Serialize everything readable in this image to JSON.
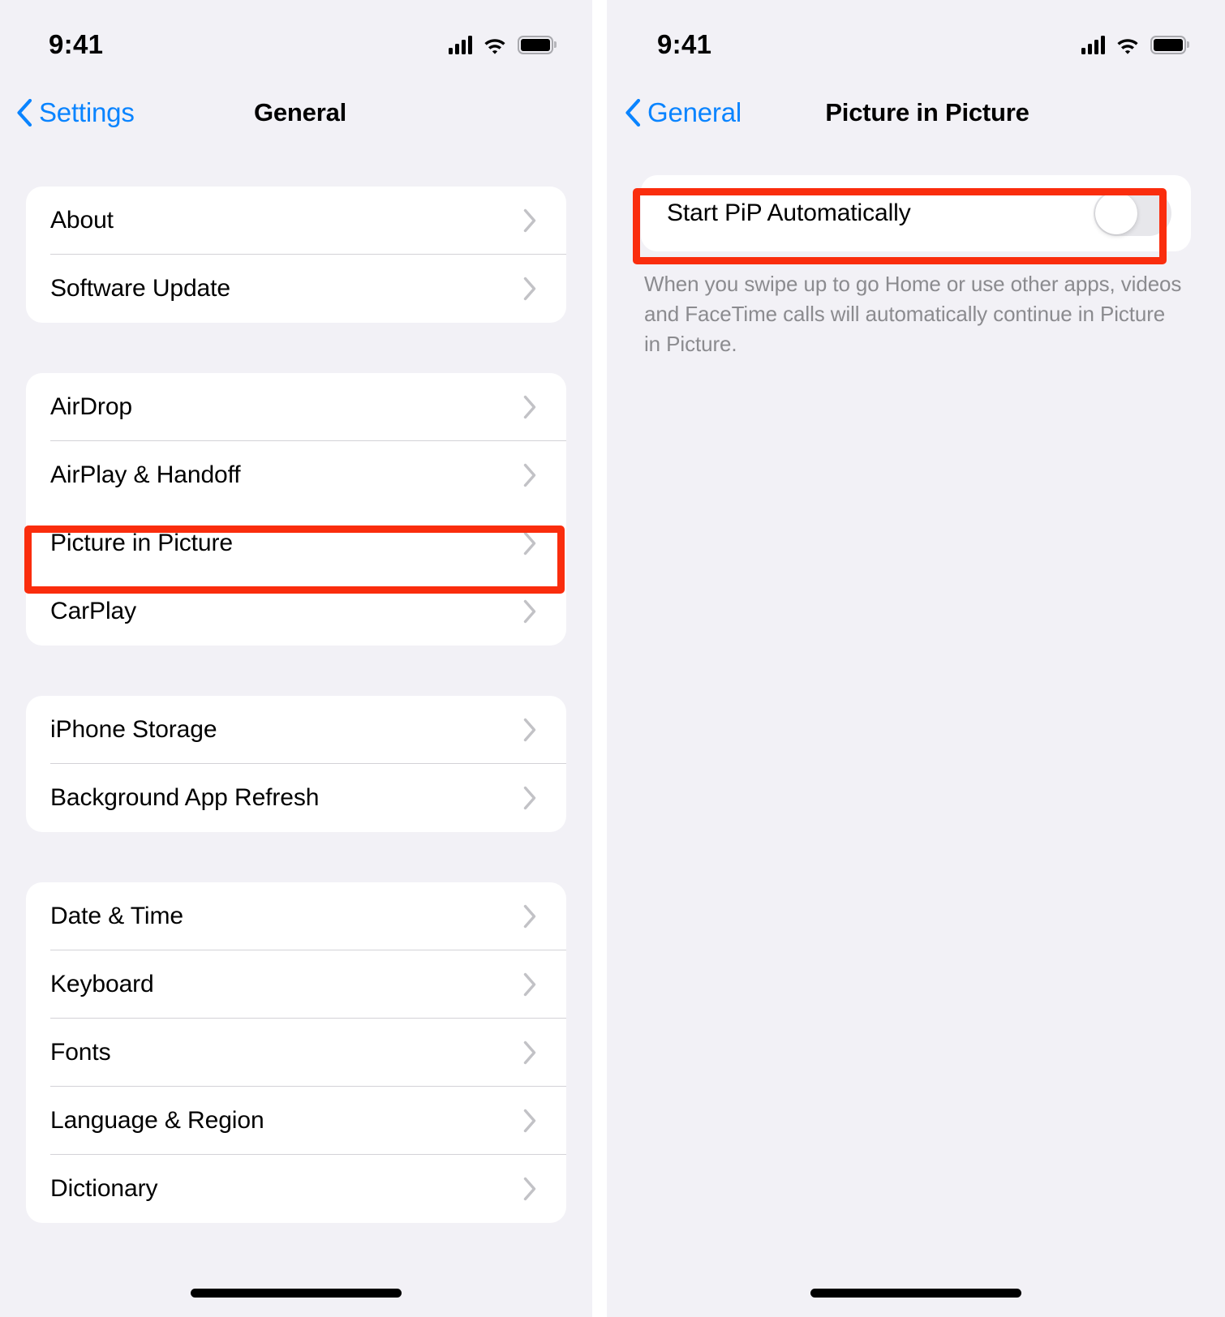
{
  "left_screen": {
    "status_bar": {
      "time": "9:41",
      "cellular_icon": "cellular-signal-icon",
      "wifi_icon": "wifi-icon",
      "battery_icon": "battery-full-icon"
    },
    "nav": {
      "back_label": "Settings",
      "back_icon": "chevron-left-icon",
      "title": "General"
    },
    "groups": [
      {
        "rows": [
          {
            "label": "About",
            "accessory": "chevron-right-icon"
          },
          {
            "label": "Software Update",
            "accessory": "chevron-right-icon"
          }
        ]
      },
      {
        "rows": [
          {
            "label": "AirDrop",
            "accessory": "chevron-right-icon"
          },
          {
            "label": "AirPlay & Handoff",
            "accessory": "chevron-right-icon"
          },
          {
            "label": "Picture in Picture",
            "accessory": "chevron-right-icon",
            "highlighted": true
          },
          {
            "label": "CarPlay",
            "accessory": "chevron-right-icon"
          }
        ]
      },
      {
        "rows": [
          {
            "label": "iPhone Storage",
            "accessory": "chevron-right-icon"
          },
          {
            "label": "Background App Refresh",
            "accessory": "chevron-right-icon"
          }
        ]
      },
      {
        "rows": [
          {
            "label": "Date & Time",
            "accessory": "chevron-right-icon"
          },
          {
            "label": "Keyboard",
            "accessory": "chevron-right-icon"
          },
          {
            "label": "Fonts",
            "accessory": "chevron-right-icon"
          },
          {
            "label": "Language & Region",
            "accessory": "chevron-right-icon"
          },
          {
            "label": "Dictionary",
            "accessory": "chevron-right-icon"
          }
        ]
      }
    ]
  },
  "right_screen": {
    "status_bar": {
      "time": "9:41",
      "cellular_icon": "cellular-signal-icon",
      "wifi_icon": "wifi-icon",
      "battery_icon": "battery-full-icon"
    },
    "nav": {
      "back_label": "General",
      "back_icon": "chevron-left-icon",
      "title": "Picture in Picture"
    },
    "setting_row": {
      "label": "Start PiP Automatically",
      "toggle_state": "off",
      "highlighted": true
    },
    "footer_note": "When you swipe up to go Home or use other apps, videos and FaceTime calls will automatically continue in Picture in Picture."
  },
  "colors": {
    "accent_blue": "#0a84ff",
    "highlight_red": "#fa2d0d",
    "background_gray": "#f2f1f6",
    "cell_white": "#ffffff",
    "separator": "#d3d2d7",
    "footer_text": "#8b8b8f",
    "toggle_off_track": "#e7e7eb"
  }
}
